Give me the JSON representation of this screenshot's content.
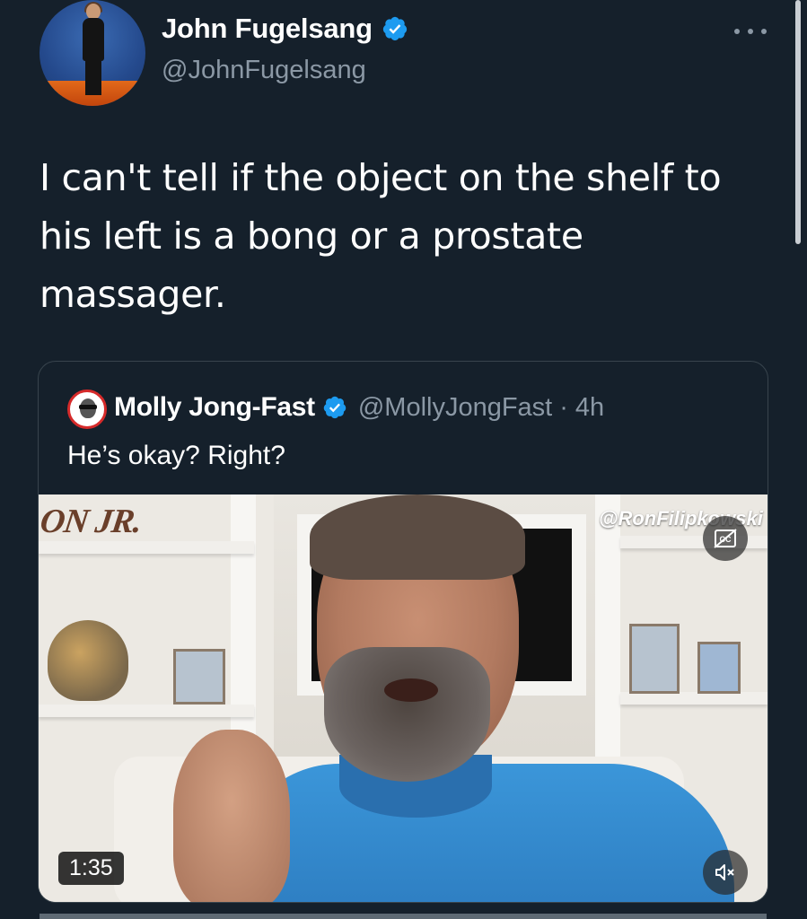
{
  "author": {
    "display_name": "John Fugelsang",
    "handle": "@JohnFugelsang",
    "verified": true
  },
  "tweet": {
    "text": "I can't tell if the object on the shelf to his left is a bong or a prostate massager."
  },
  "quoted_tweet": {
    "display_name": "Molly Jong-Fast",
    "handle": "@MollyJongFast",
    "separator": "·",
    "time": "4h",
    "verified": true,
    "text": "He’s okay? Right?",
    "video": {
      "overlay_logo": "ON JR.",
      "watermark": "@RonFilipkowski",
      "duration": "1:35"
    }
  },
  "icons": {
    "verified": "verified-badge-icon",
    "more": "more-options-icon",
    "captions": "closed-captions-icon",
    "mute": "muted-speaker-icon"
  },
  "colors": {
    "background": "#15202b",
    "verified_blue": "#1d9bf0",
    "secondary_text": "#8b98a5",
    "border": "#38444d"
  }
}
